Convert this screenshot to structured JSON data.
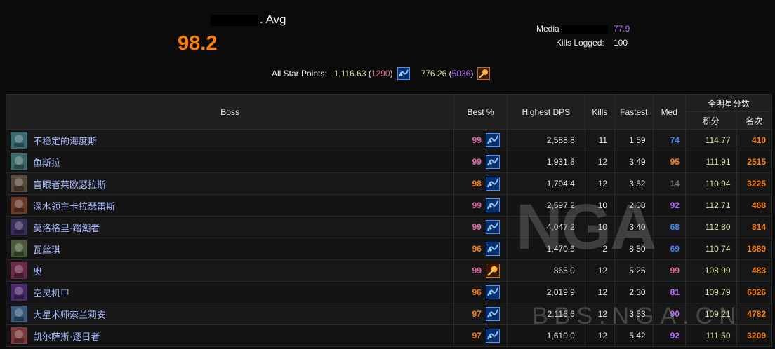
{
  "summary": {
    "avg_label": ". Avg",
    "avg_value": "98.2",
    "median_label": "Media",
    "median_value": "77.9",
    "kills_label": "Kills Logged:",
    "kills_value": "100",
    "all_star_label": "All Star Points:",
    "all_star_1_points": "1,116.63",
    "all_star_1_rank": "1290",
    "all_star_1_icon": "rank-badge-icon",
    "all_star_2_points": "776.26",
    "all_star_2_rank": "5036",
    "all_star_2_icon": "orb-badge-icon"
  },
  "table": {
    "headers": {
      "boss": "Boss",
      "best_pct": "Best %",
      "highest_dps": "Highest DPS",
      "kills": "Kills",
      "fastest": "Fastest",
      "med": "Med",
      "all_star": "全明星分数",
      "score": "积分",
      "rank": "名次"
    },
    "rows": [
      {
        "boss": "不稳定的海度斯",
        "best": "99",
        "best_color": "pink",
        "icon": "rank-badge-icon",
        "dps": "2,588.8",
        "kills": "11",
        "fastest": "1:59",
        "med": "74",
        "med_color": "blue",
        "score": "114.77",
        "rank": "410",
        "boss_color": "#3a6a72"
      },
      {
        "boss": "鱼斯拉",
        "best": "99",
        "best_color": "pink",
        "icon": "rank-badge-icon",
        "dps": "1,931.8",
        "kills": "12",
        "fastest": "3:49",
        "med": "95",
        "med_color": "orange",
        "score": "111.91",
        "rank": "2515",
        "boss_color": "#3d6b6a"
      },
      {
        "boss": "盲眼者莱欧瑟拉斯",
        "best": "98",
        "best_color": "orange",
        "icon": "rank-badge-icon",
        "dps": "1,794.4",
        "kills": "12",
        "fastest": "3:52",
        "med": "14",
        "med_color": "gray",
        "score": "110.94",
        "rank": "3225",
        "boss_color": "#5a4a3a"
      },
      {
        "boss": "深水领主卡拉瑟雷斯",
        "best": "99",
        "best_color": "pink",
        "icon": "rank-badge-icon",
        "dps": "2,597.2",
        "kills": "10",
        "fastest": "2:08",
        "med": "92",
        "med_color": "purple",
        "score": "112.71",
        "rank": "468",
        "boss_color": "#6a3a2a"
      },
      {
        "boss": "莫洛格里·踏潮者",
        "best": "99",
        "best_color": "pink",
        "icon": "rank-badge-icon",
        "dps": "4,047.2",
        "kills": "10",
        "fastest": "3:40",
        "med": "68",
        "med_color": "blue",
        "score": "112.80",
        "rank": "814",
        "boss_color": "#3a2f5a"
      },
      {
        "boss": "瓦丝琪",
        "best": "96",
        "best_color": "orange",
        "icon": "rank-badge-icon",
        "dps": "1,470.6",
        "kills": "2",
        "fastest": "8:50",
        "med": "69",
        "med_color": "blue",
        "score": "110.74",
        "rank": "1889",
        "boss_color": "#4a5a3a"
      },
      {
        "boss": "奥",
        "best": "99",
        "best_color": "pink",
        "icon": "orb-badge-icon",
        "dps": "865.0",
        "kills": "12",
        "fastest": "5:25",
        "med": "99",
        "med_color": "pink",
        "score": "108.99",
        "rank": "483",
        "boss_color": "#6a2a4a"
      },
      {
        "boss": "空灵机甲",
        "best": "96",
        "best_color": "orange",
        "icon": "rank-badge-icon",
        "dps": "2,019.9",
        "kills": "12",
        "fastest": "2:30",
        "med": "81",
        "med_color": "purple",
        "score": "109.79",
        "rank": "6326",
        "boss_color": "#4a2a6a"
      },
      {
        "boss": "大星术师索兰莉安",
        "best": "97",
        "best_color": "orange",
        "icon": "rank-badge-icon",
        "dps": "2,116.6",
        "kills": "12",
        "fastest": "3:53",
        "med": "90",
        "med_color": "purple",
        "score": "109.21",
        "rank": "4782",
        "boss_color": "#3a5a7a"
      },
      {
        "boss": "凯尔萨斯·逐日者",
        "best": "97",
        "best_color": "orange",
        "icon": "rank-badge-icon",
        "dps": "1,610.0",
        "kills": "12",
        "fastest": "5:42",
        "med": "92",
        "med_color": "purple",
        "score": "111.50",
        "rank": "3209",
        "boss_color": "#7a3a3a"
      }
    ]
  },
  "watermark": {
    "main": "NGA",
    "sub": "BBS.NGA.CN"
  }
}
